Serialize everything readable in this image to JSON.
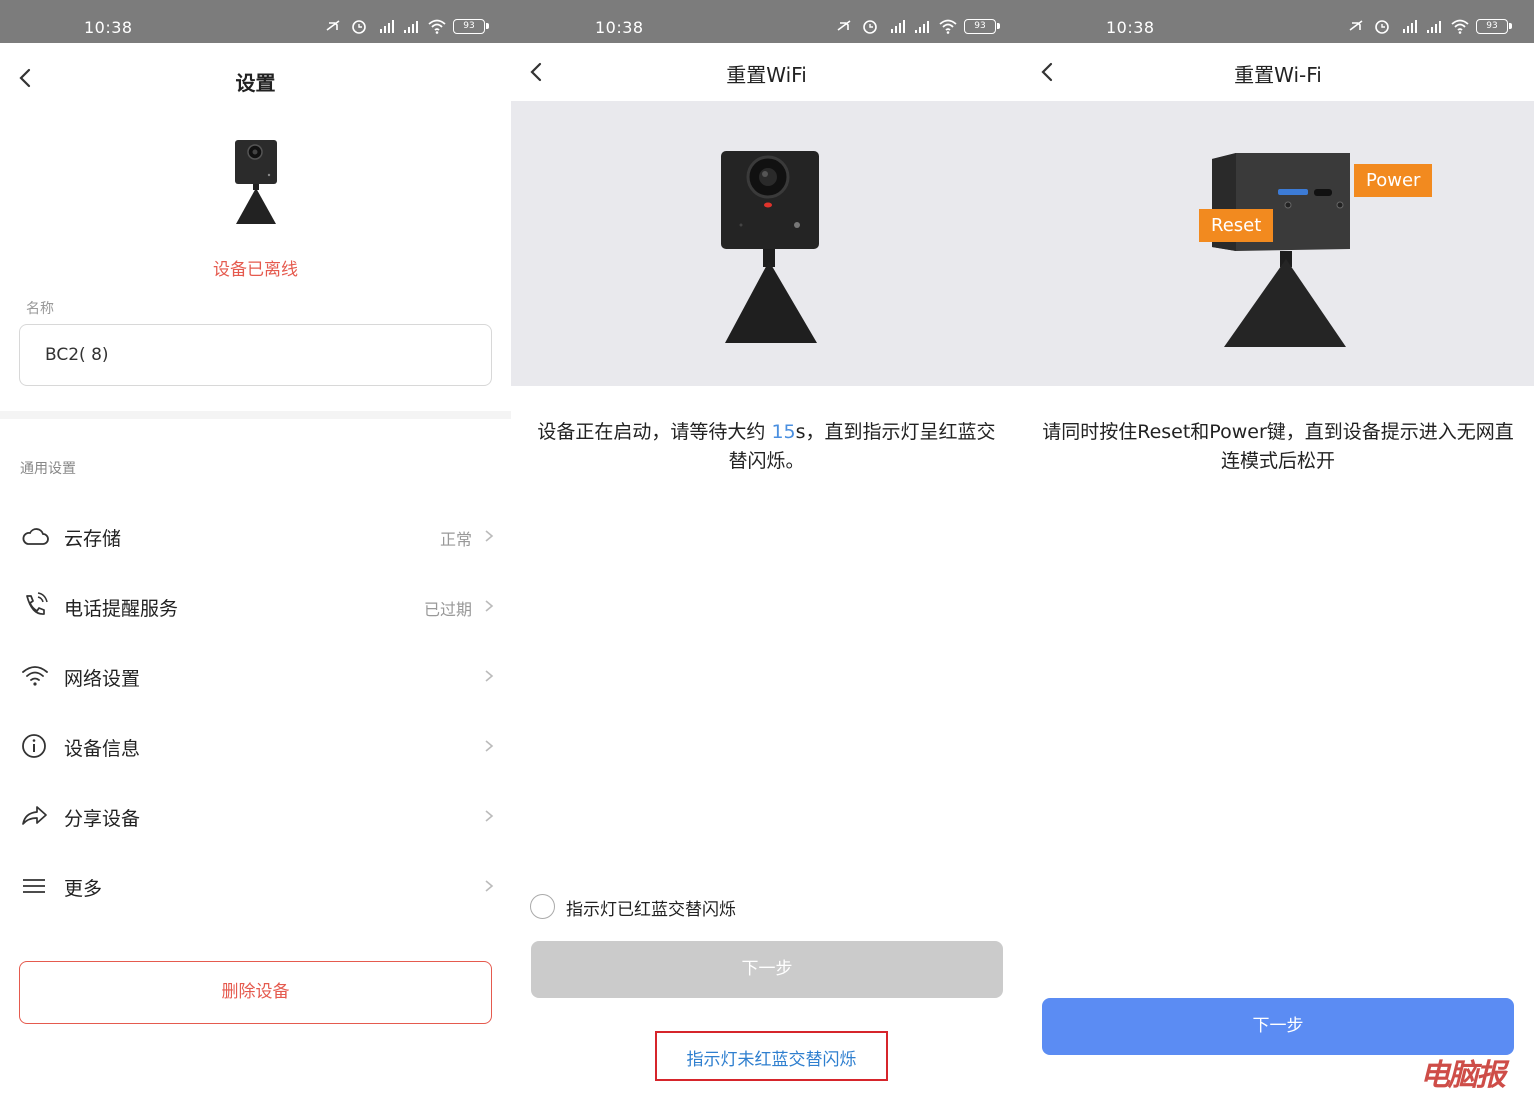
{
  "status_bar": {
    "time": "10:38",
    "battery": "93"
  },
  "screen1": {
    "title": "设置",
    "offline_status": "设备已离线",
    "name_label": "名称",
    "name_value": "BC2(         8)",
    "section_title": "通用设置",
    "menu": [
      {
        "label": "云存储",
        "value": "正常",
        "icon": "cloud-icon"
      },
      {
        "label": "电话提醒服务",
        "value": "已过期",
        "icon": "phone-icon"
      },
      {
        "label": "网络设置",
        "value": "",
        "icon": "wifi-icon"
      },
      {
        "label": "设备信息",
        "value": "",
        "icon": "info-icon"
      },
      {
        "label": "分享设备",
        "value": "",
        "icon": "share-icon"
      },
      {
        "label": "更多",
        "value": "",
        "icon": "menu-icon"
      }
    ],
    "delete_button": "删除设备"
  },
  "screen2": {
    "title": "重置WiFi",
    "instruction_a": "设备正在启动，请等待大约 ",
    "instruction_highlight": "15",
    "instruction_b": "s，直到指示灯呈红蓝交替闪烁。",
    "checkbox_label": "指示灯已红蓝交替闪烁",
    "next_button": "下一步",
    "help_link": "指示灯未红蓝交替闪烁"
  },
  "screen3": {
    "title": "重置Wi-Fi",
    "instruction": "请同时按住Reset和Power键，直到设备提示进入无网直连模式后松开",
    "callout_reset": "Reset",
    "callout_power": "Power",
    "next_button": "下一步"
  },
  "watermark": "电脑报",
  "colors": {
    "accent_red": "#e55a4e",
    "primary_blue": "#5b8cf3",
    "link_blue": "#2f7fcf",
    "callout_orange": "#f28a1f"
  }
}
